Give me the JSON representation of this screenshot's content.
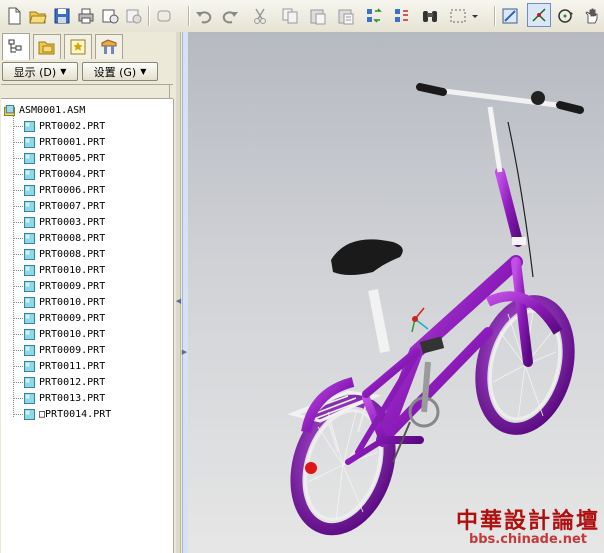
{
  "toolbar": {
    "icons": [
      "new-file-icon",
      "open-folder-icon",
      "save-icon",
      "print-icon",
      "send-mail-icon",
      "mail-attach-icon",
      "undo-icon",
      "redo-icon",
      "cut-icon",
      "copy-icon",
      "paste-icon",
      "paste-special-icon",
      "regenerate-icon",
      "regen-manager-icon",
      "find-binoculars-icon",
      "select-box-icon",
      "view-orient-icon",
      "datum-point-icon",
      "spin-center-icon",
      "pan-hand-icon"
    ]
  },
  "panel": {
    "tabs": [
      "model-tree-tab",
      "folder-browser-tab",
      "favorites-tab",
      "connections-tab"
    ],
    "show_button": "显示 (D)",
    "settings_button": "设置 (G)",
    "tree": {
      "root": "ASM0001.ASM",
      "items": [
        "PRT0002.PRT",
        "PRT0001.PRT",
        "PRT0005.PRT",
        "PRT0004.PRT",
        "PRT0006.PRT",
        "PRT0007.PRT",
        "PRT0003.PRT",
        "PRT0008.PRT",
        "PRT0008.PRT",
        "PRT0010.PRT",
        "PRT0009.PRT",
        "PRT0010.PRT",
        "PRT0009.PRT",
        "PRT0010.PRT",
        "PRT0009.PRT",
        "PRT0011.PRT",
        "PRT0012.PRT",
        "PRT0013.PRT",
        "PRT0014.PRT"
      ],
      "last_item_prefix": "□"
    }
  },
  "viewport": {
    "model_color": "#8a1bb8",
    "watermark_cn": "中華設計論壇",
    "watermark_url": "bbs.chinade.net"
  }
}
